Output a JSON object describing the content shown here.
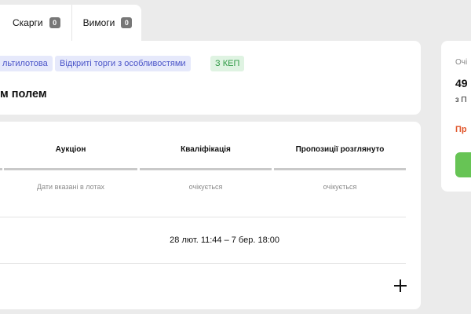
{
  "tabs": [
    {
      "label": "Скарги",
      "count": "0"
    },
    {
      "label": "Вимоги",
      "count": "0"
    }
  ],
  "header": {
    "tags": [
      {
        "label": "льтилотова",
        "style": "blue"
      },
      {
        "label": "Відкриті торги з особливостями",
        "style": "blue"
      },
      {
        "label": "З КЕП",
        "style": "green"
      }
    ],
    "title": "м полем"
  },
  "stages": [
    {
      "label": "Аукціон",
      "status": "Дати вказані в лотах"
    },
    {
      "label": "Кваліфікація",
      "status": "очікується"
    },
    {
      "label": "Пропозиції розглянуто",
      "status": "очікується"
    }
  ],
  "period": {
    "range": "28 лют. 11:44 – 7 бер. 18:00"
  },
  "side": {
    "label": "Очі",
    "amount": "49",
    "vat": "з П",
    "warning": "Пр"
  },
  "colors": {
    "tag_blue_bg": "#e6e9fb",
    "tag_blue_text": "#4a54c8",
    "tag_green_bg": "#dff3e2",
    "tag_green_text": "#2f9a45",
    "warning": "#e0562b",
    "primary_button": "#67c455"
  }
}
